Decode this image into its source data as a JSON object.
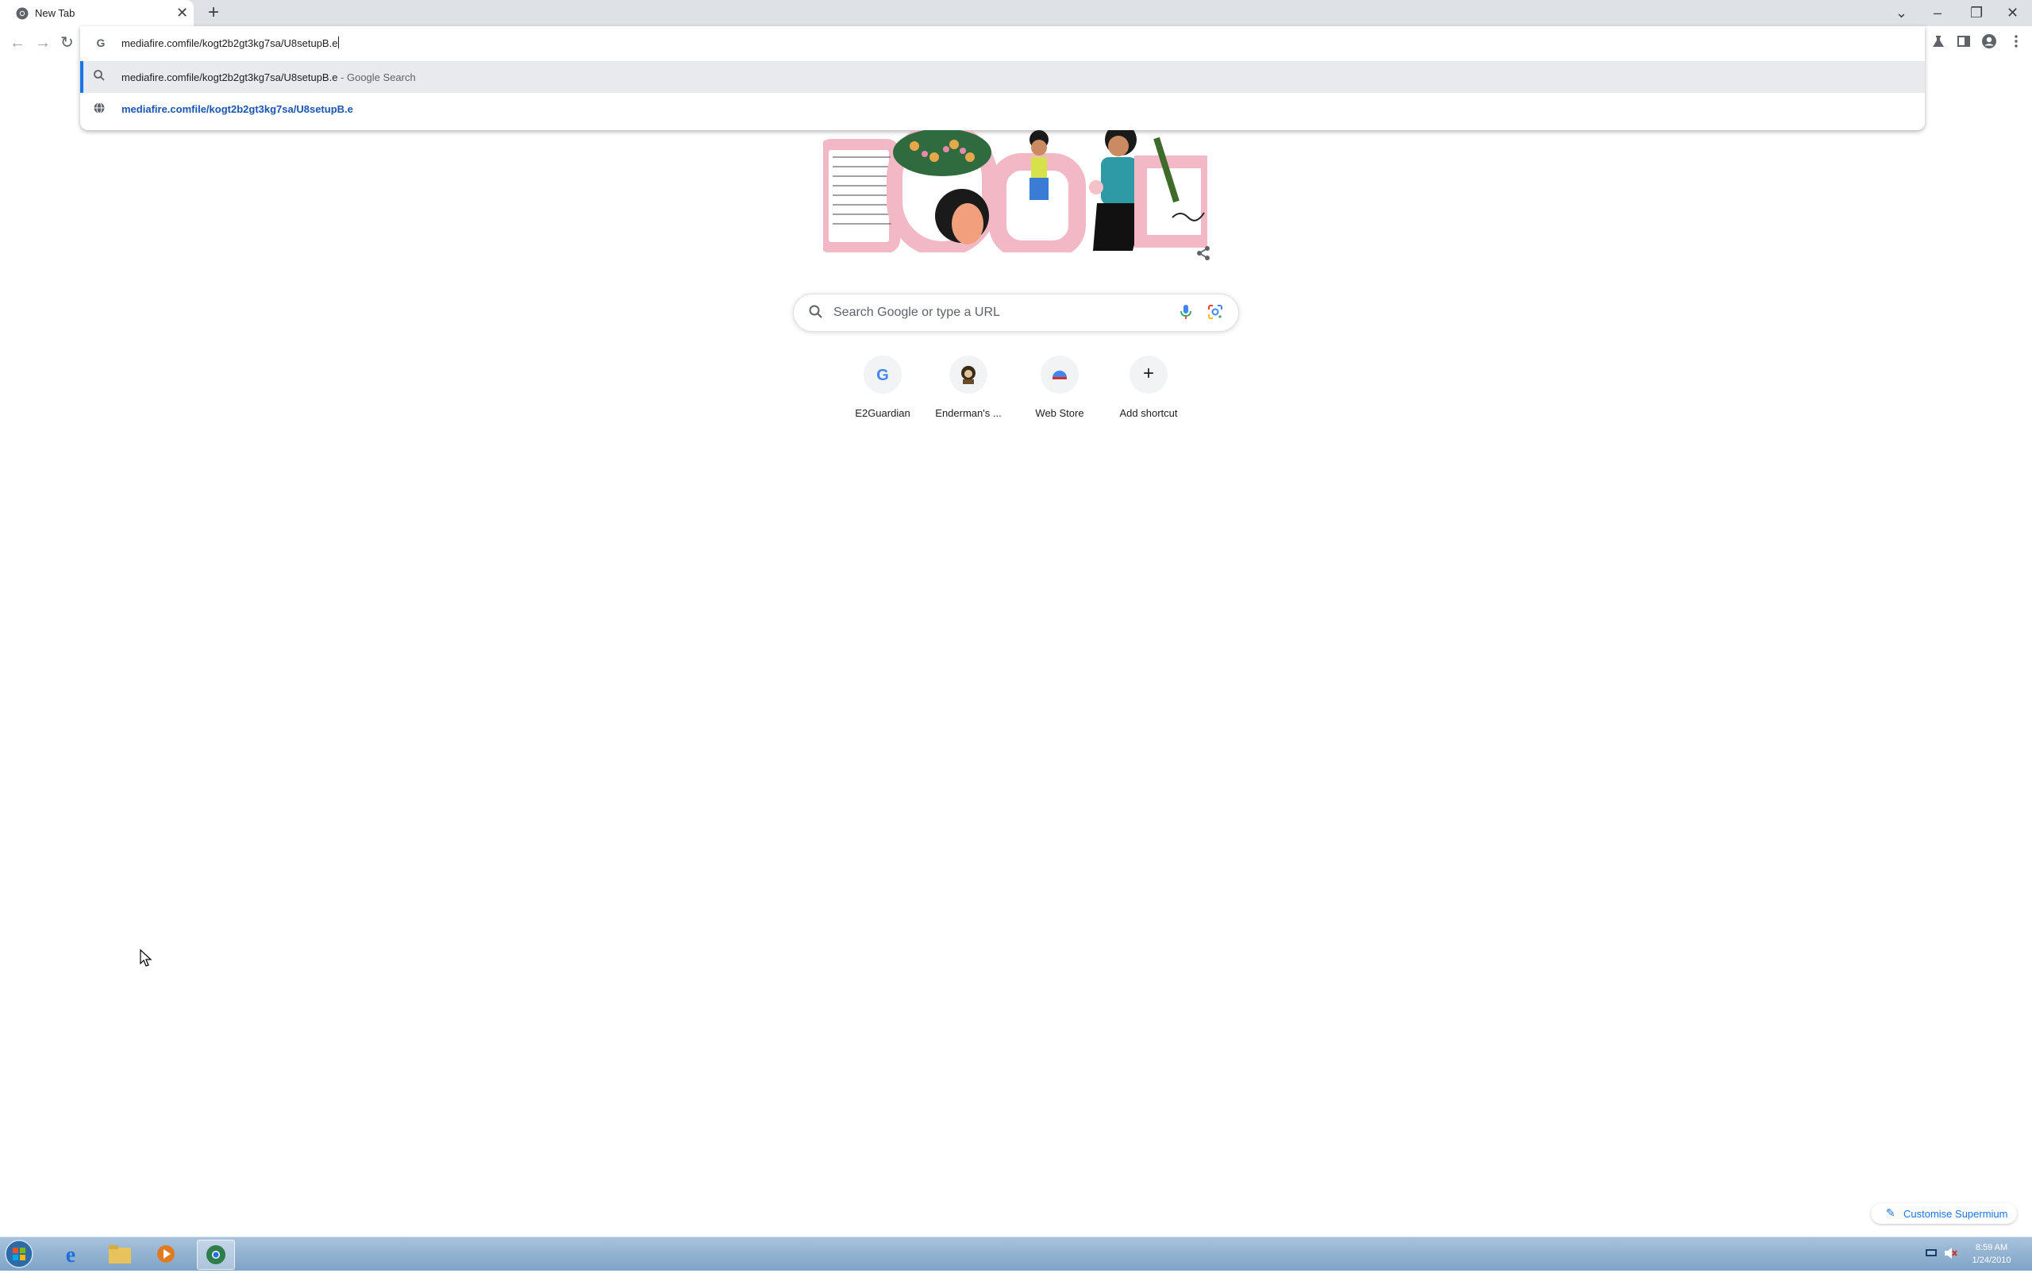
{
  "browser": {
    "tab": {
      "title": "New Tab",
      "close_glyph": "✕"
    },
    "new_tab_glyph": "+",
    "window_controls": {
      "dropdown": "⌄",
      "minimize": "–",
      "restore": "❐",
      "close": "✕"
    },
    "nav": {
      "back": "←",
      "forward": "→",
      "reload": "↻"
    },
    "omnibox": {
      "value": "mediafire.comfile/kogt2b2gt3kg7sa/U8setupB.e",
      "suggestions": [
        {
          "text": "mediafire.comfile/kogt2b2gt3kg7sa/U8setupB.e",
          "suffix": " - Google Search",
          "icon": "search-icon"
        },
        {
          "text": "mediafire.comfile/kogt2b2gt3kg7sa/U8setupB.e",
          "icon": "globe-icon"
        }
      ]
    }
  },
  "ntp": {
    "search_placeholder": "Search Google or type a URL",
    "shortcuts": [
      {
        "label": "E2Guardian",
        "icon": "google-g-icon"
      },
      {
        "label": "Enderman's ...",
        "icon": "enderman-icon"
      },
      {
        "label": "Web Store",
        "icon": "web-store-icon"
      },
      {
        "label": "Add shortcut",
        "icon": "plus-icon",
        "glyph": "+"
      }
    ],
    "customise_label": "Customise Supermium"
  },
  "taskbar": {
    "time": "8:59 AM",
    "date": "1/24/2010"
  },
  "colors": {
    "accent": "#1a73e8",
    "tabstrip": "#dee1e6",
    "taskbar": "#8fb0d0"
  }
}
